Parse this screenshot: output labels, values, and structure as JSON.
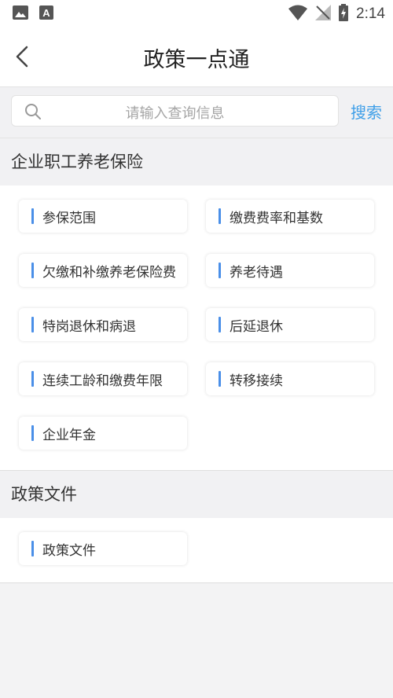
{
  "status_bar": {
    "time": "2:14",
    "left_icons": [
      "image-icon",
      "text-icon"
    ],
    "right_icons": [
      "wifi-icon",
      "no-signal-icon",
      "battery-charging-icon"
    ]
  },
  "header": {
    "title": "政策一点通",
    "back_icon": "chevron-left-icon"
  },
  "search": {
    "placeholder": "请输入查询信息",
    "button_label": "搜索",
    "accent_color": "#3f9fe8"
  },
  "sections": [
    {
      "title": "企业职工养老保险",
      "items": [
        "参保范围",
        "缴费费率和基数",
        "欠缴和补缴养老保险费",
        "养老待遇",
        "特岗退休和病退",
        "后延退休",
        "连续工龄和缴费年限",
        "转移接续",
        "企业年金"
      ]
    },
    {
      "title": "政策文件",
      "items": [
        "政策文件"
      ]
    }
  ],
  "colors": {
    "item_bar": "#4a8fe8"
  }
}
